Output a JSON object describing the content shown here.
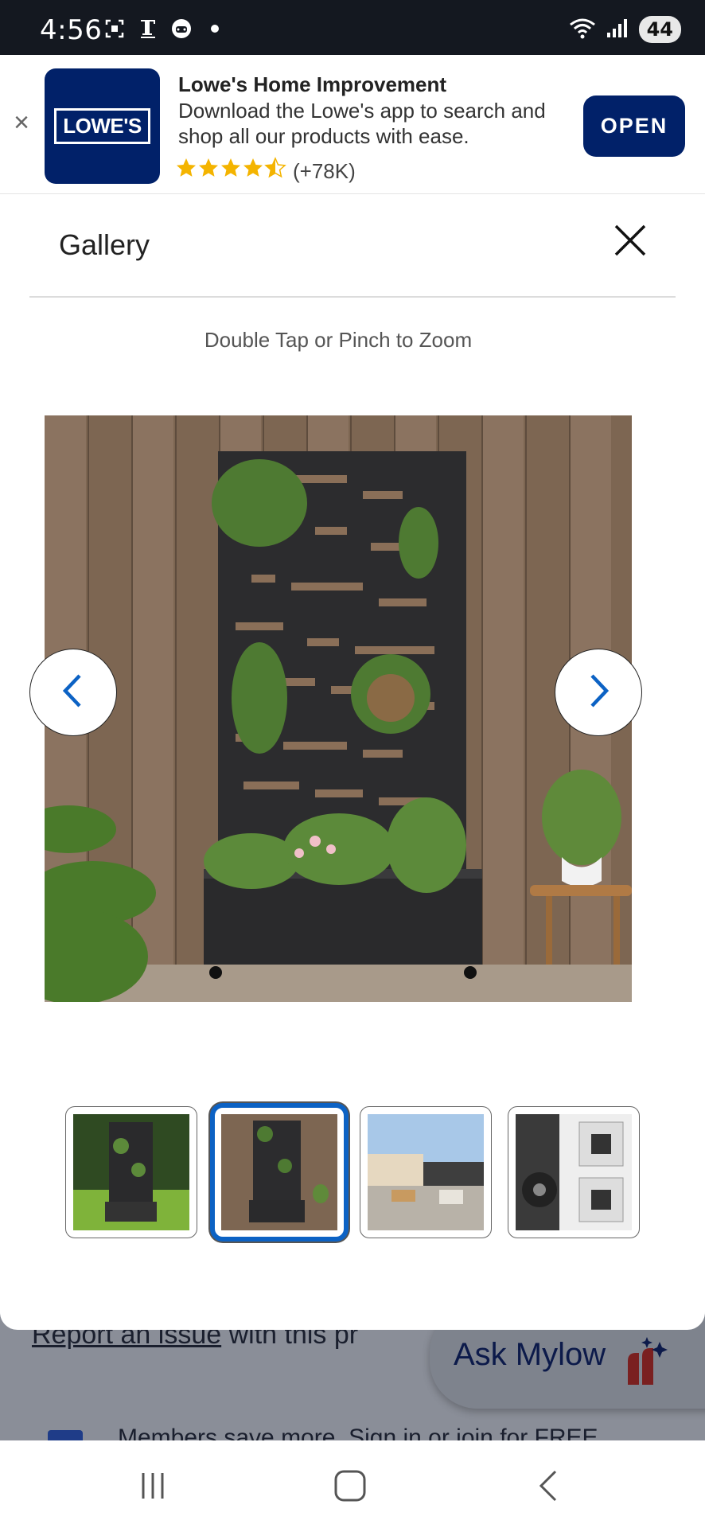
{
  "status_bar": {
    "time": "4:56",
    "battery": "44"
  },
  "app_banner": {
    "title": "Lowe's Home Improvement",
    "description": "Download the Lowe's app to search and shop all our products with ease.",
    "rating_stars": "★★★★☆",
    "rating_count": "(+78K)",
    "rating_value": 4.5,
    "open_label": "OPEN",
    "logo_text": "LOWE'S",
    "brand_color": "#012169"
  },
  "gallery": {
    "title": "Gallery",
    "zoom_hint": "Double Tap or Pinch to Zoom",
    "thumbnails": [
      {
        "label": "planter-on-lawn",
        "active": false
      },
      {
        "label": "planter-against-wall",
        "active": true
      },
      {
        "label": "patio-scene",
        "active": false
      },
      {
        "label": "caster-wheel-detail",
        "active": false
      }
    ],
    "accent_color": "#0c62c4"
  },
  "background_page": {
    "report_link": "Report an issue",
    "report_rest": " with this pr",
    "members_text": "Members save more. Sign in or join for FREE",
    "ask_mylow": "Ask Mylow"
  },
  "nav_bar": {
    "buttons": [
      "recent-apps",
      "home",
      "back"
    ]
  }
}
